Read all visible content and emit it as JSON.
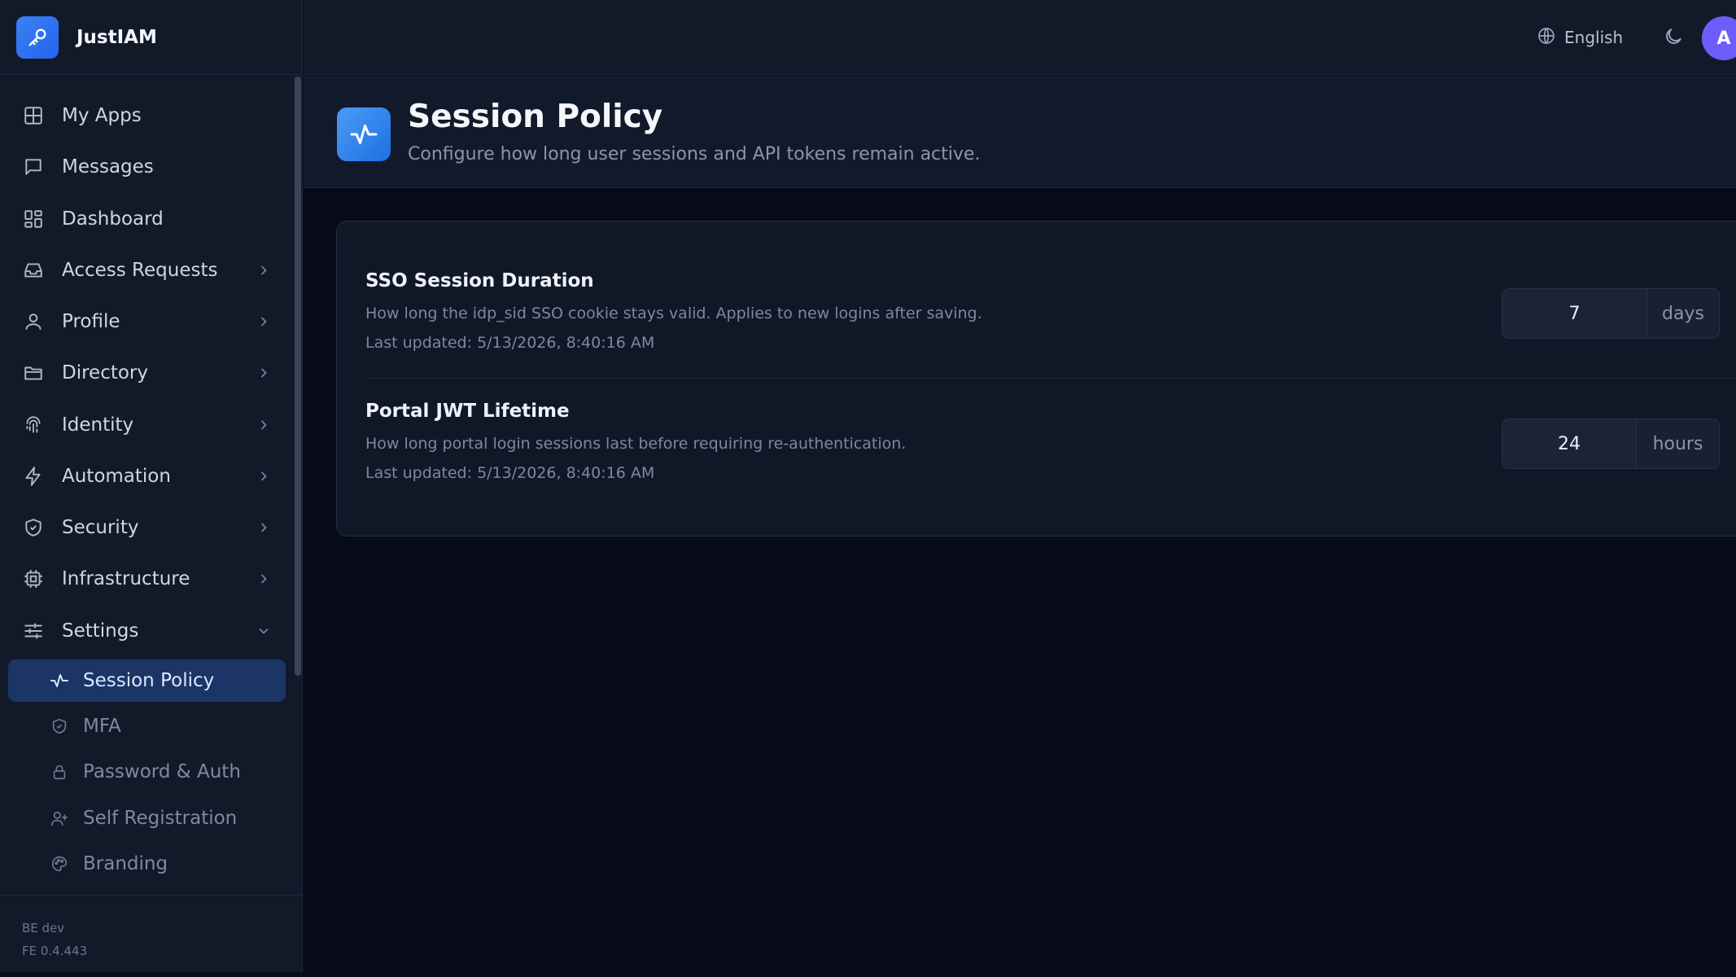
{
  "brand": {
    "name": "JustIAM"
  },
  "topbar": {
    "language": "English",
    "avatar_initial": "A"
  },
  "sidebar": {
    "items": [
      {
        "label": "My Apps"
      },
      {
        "label": "Messages"
      },
      {
        "label": "Dashboard"
      },
      {
        "label": "Access Requests"
      },
      {
        "label": "Profile"
      },
      {
        "label": "Directory"
      },
      {
        "label": "Identity"
      },
      {
        "label": "Automation"
      },
      {
        "label": "Security"
      },
      {
        "label": "Infrastructure"
      },
      {
        "label": "Settings"
      }
    ],
    "settings_children": [
      {
        "label": "Session Policy",
        "active": true
      },
      {
        "label": "MFA"
      },
      {
        "label": "Password & Auth"
      },
      {
        "label": "Self Registration"
      },
      {
        "label": "Branding"
      }
    ],
    "footer": {
      "be": "BE dev",
      "fe": "FE 0.4.443"
    }
  },
  "page": {
    "title": "Session Policy",
    "subtitle": "Configure how long user sessions and API tokens remain active."
  },
  "settings": [
    {
      "title": "SSO Session Duration",
      "description": "How long the idp_sid SSO cookie stays valid. Applies to new logins after saving.",
      "updated": "Last updated: 5/13/2026, 8:40:16 AM",
      "value": "7",
      "unit": "days"
    },
    {
      "title": "Portal JWT Lifetime",
      "description": "How long portal login sessions last before requiring re-authentication.",
      "updated": "Last updated: 5/13/2026, 8:40:16 AM",
      "value": "24",
      "unit": "hours"
    }
  ],
  "colors": {
    "accent": "#3b82f6",
    "active_nav_bg": "#1c3567",
    "avatar": "#6d5dfc",
    "background": "#070b17",
    "panel": "#121a2a"
  }
}
